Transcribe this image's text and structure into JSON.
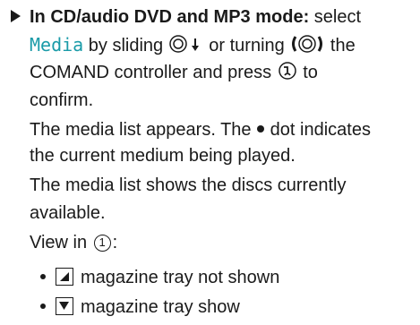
{
  "step": {
    "lead": "In CD/audio DVD and MP3 mode:",
    "select_text": " select",
    "media_label": "Media",
    "by_sliding": " by sliding ",
    "or_turning": " or turning ",
    "the": " the",
    "line3": "COMAND controller and press ",
    "to": " to",
    "confirm": "confirm.",
    "result1": "The media list appears. The ",
    "result1_end": " dot indicates",
    "result2": "the current medium being played.",
    "shows1": "The media list shows the discs currently",
    "shows2": "available.",
    "view_in": "View in ",
    "view_num": "1",
    "view_end": ":",
    "items": [
      "magazine tray not shown",
      "magazine tray show"
    ]
  },
  "colors": {
    "accent": "#1a9ba8",
    "text": "#1a1a1a"
  },
  "icons": [
    "slide-down-icon",
    "rotate-icon",
    "press-icon",
    "tray-collapsed-icon",
    "tray-expanded-icon"
  ]
}
